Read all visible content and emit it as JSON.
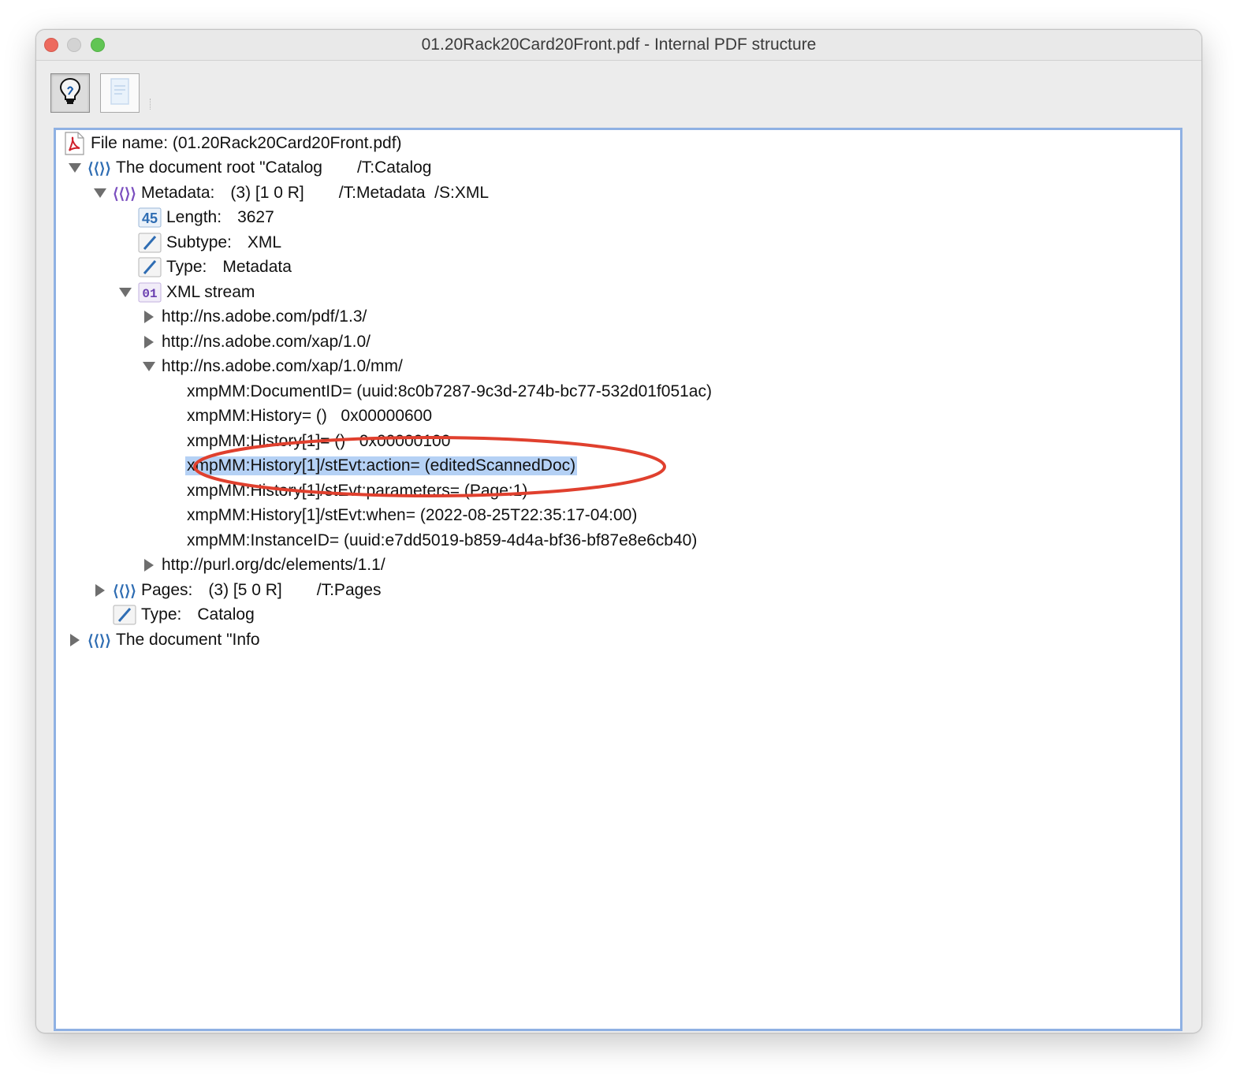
{
  "window": {
    "title": "01.20Rack20Card20Front.pdf - Internal PDF structure"
  },
  "toolbar": {
    "buttons": [
      {
        "name": "lightbulb-icon",
        "pressed": true
      },
      {
        "name": "document-icon",
        "pressed": false
      }
    ]
  },
  "tree": {
    "file_name": "File name: (01.20Rack20Card20Front.pdf)",
    "root": {
      "label": "The document root \"Catalog",
      "type": "/T:Catalog",
      "metadata": {
        "label": "Metadata:",
        "ref": "(3) [1 0 R]",
        "type": "/T:Metadata  /S:XML",
        "length": {
          "key": "Length:",
          "value": "3627"
        },
        "subtype": {
          "key": "Subtype:",
          "value": "XML"
        },
        "mtype": {
          "key": "Type:",
          "value": "Metadata"
        },
        "xml_stream": {
          "label": "XML stream",
          "ns_pdf": "http://ns.adobe.com/pdf/1.3/",
          "ns_xap": "http://ns.adobe.com/xap/1.0/",
          "ns_mm": "http://ns.adobe.com/xap/1.0/mm/",
          "mm_entries": [
            "xmpMM:DocumentID= (uuid:8c0b7287-9c3d-274b-bc77-532d01f051ac)",
            "xmpMM:History= ()   0x00000600",
            "xmpMM:History[1]= ()   0x00000100",
            "xmpMM:History[1]/stEvt:action= (editedScannedDoc)",
            "xmpMM:History[1]/stEvt:parameters= (Page:1)",
            "xmpMM:History[1]/stEvt:when= (2022-08-25T22:35:17-04:00)",
            "xmpMM:InstanceID= (uuid:e7dd5019-b859-4d4a-bf36-bf87e8e6cb40)"
          ],
          "ns_dc": "http://purl.org/dc/elements/1.1/"
        }
      },
      "pages": {
        "label": "Pages:",
        "ref": "(3) [5 0 R]",
        "type": "/T:Pages"
      },
      "catalog_type": {
        "key": "Type:",
        "value": "Catalog"
      }
    },
    "info": {
      "label": "The document \"Info"
    }
  },
  "colors": {
    "selection": "#b5d1f5",
    "annotation": "#e0402e",
    "panel_border": "#8fb1e3"
  }
}
